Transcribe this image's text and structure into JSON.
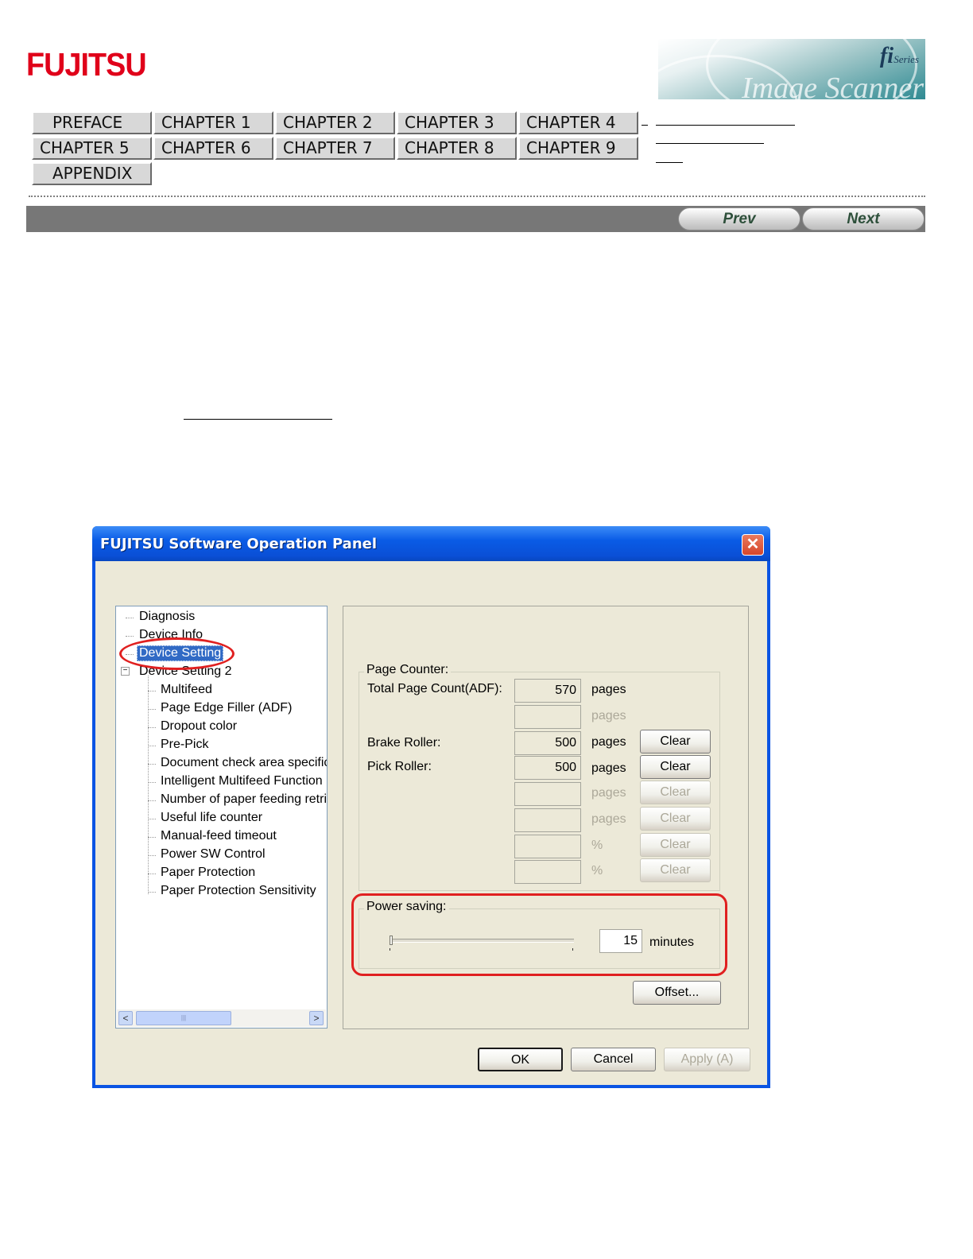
{
  "header": {
    "logo": "FUJITSU",
    "banner_mark": "fi",
    "banner_series": "Series",
    "banner_word": "Image Scanner"
  },
  "nav": {
    "buttons": [
      "PREFACE",
      "CHAPTER 1",
      "CHAPTER 2",
      "CHAPTER 3",
      "CHAPTER 4",
      "CHAPTER 5",
      "CHAPTER 6",
      "CHAPTER 7",
      "CHAPTER 8",
      "CHAPTER 9",
      "APPENDIX"
    ]
  },
  "pager": {
    "prev": "Prev",
    "next": "Next"
  },
  "dialog": {
    "title": "FUJITSU Software Operation Panel",
    "close_glyph": "✕",
    "tree": {
      "items": [
        "Diagnosis",
        "Device Info",
        "Device Setting",
        "Device Setting 2"
      ],
      "expander": "−",
      "children": [
        "Multifeed",
        "Page Edge Filler (ADF)",
        "Dropout color",
        "Pre-Pick",
        "Document check area specific",
        "Intelligent Multifeed Function",
        "Number of paper feeding retrie",
        "Useful life counter",
        "Manual-feed timeout",
        "Power SW Control",
        "Paper Protection",
        "Paper Protection Sensitivity"
      ],
      "scroll_left": "<",
      "scroll_right": ">",
      "scroll_grip": "|||"
    },
    "page_counter": {
      "label": "Page Counter:",
      "rows": [
        {
          "label": "Total Page Count(ADF):",
          "value": "570",
          "unit": "pages",
          "enabled": true,
          "button": ""
        },
        {
          "label": "",
          "value": "",
          "unit": "pages",
          "enabled": false,
          "button": ""
        },
        {
          "label": "Brake Roller:",
          "value": "500",
          "unit": "pages",
          "enabled": true,
          "button": "Clear"
        },
        {
          "label": "Pick Roller:",
          "value": "500",
          "unit": "pages",
          "enabled": true,
          "button": "Clear"
        },
        {
          "label": "",
          "value": "",
          "unit": "pages",
          "enabled": false,
          "button": "Clear"
        },
        {
          "label": "",
          "value": "",
          "unit": "pages",
          "enabled": false,
          "button": "Clear"
        },
        {
          "label": "",
          "value": "",
          "unit": "%",
          "enabled": false,
          "button": "Clear"
        },
        {
          "label": "",
          "value": "",
          "unit": "%",
          "enabled": false,
          "button": "Clear"
        }
      ]
    },
    "power_saving": {
      "label": "Power saving:",
      "value": "15",
      "unit": "minutes",
      "slider_fraction": 0.0
    },
    "buttons": {
      "offset": "Offset...",
      "ok": "OK",
      "cancel": "Cancel",
      "apply": "Apply (A)"
    }
  },
  "colors": {
    "highlight_ring": "#e02020",
    "selection": "#316ac5",
    "titlebar": "#0a54e3"
  }
}
